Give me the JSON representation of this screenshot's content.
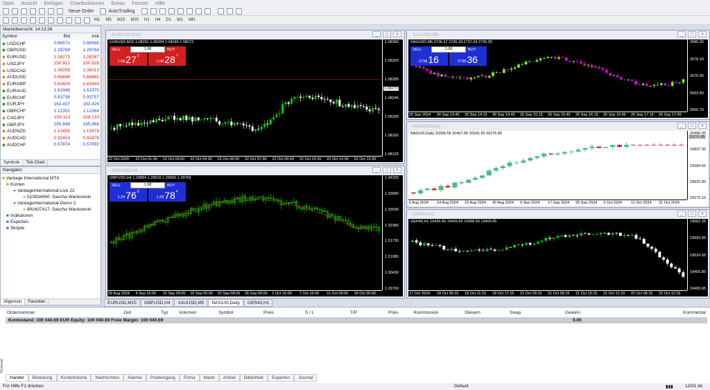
{
  "menu": [
    "Datei",
    "Ansicht",
    "Einfügen",
    "Chartfunktionen",
    "Extras",
    "Fenster",
    "Hilfe"
  ],
  "toolbar": {
    "new_order": "Neue Order",
    "autotrading": "AutoTrading",
    "timeframes": [
      "M1",
      "M5",
      "M15",
      "M30",
      "H1",
      "H4",
      "D1",
      "W1",
      "MN"
    ]
  },
  "market_watch": {
    "title": "Marktübersicht: 14:13:26",
    "col_symbol": "Symbol",
    "col_bid": "Bid",
    "col_ask": "Ask",
    "rows": [
      {
        "s": "USDCHF",
        "b": "0.86571",
        "a": "0.86586",
        "d": "up"
      },
      {
        "s": "GBPUSD",
        "b": "1.29769",
        "a": "1.29784",
        "d": "up"
      },
      {
        "s": "EURUSD",
        "b": "1.08273",
        "a": "1.08287",
        "d": "dn"
      },
      {
        "s": "USDJPY",
        "b": "150.912",
        "a": "150.928",
        "d": "dn"
      },
      {
        "s": "USDCAD",
        "b": "1.38299",
        "a": "1.38313",
        "d": "dn"
      },
      {
        "s": "AUDUSD",
        "b": "0.66848",
        "a": "0.66865",
        "d": "dn"
      },
      {
        "s": "EURGBP",
        "b": "0.83428",
        "a": "0.83443",
        "d": "dn"
      },
      {
        "s": "EURAUD",
        "b": "1.61948",
        "a": "1.61970",
        "d": "up"
      },
      {
        "s": "EURCHF",
        "b": "0.93738",
        "a": "0.93757",
        "d": "up"
      },
      {
        "s": "EURJPY",
        "b": "163.407",
        "a": "163.426",
        "d": "up"
      },
      {
        "s": "GBPCHF",
        "b": "1.12352",
        "a": "1.12364",
        "d": "up"
      },
      {
        "s": "CADJPY",
        "b": "109.113",
        "a": "109.133",
        "d": "dn"
      },
      {
        "s": "GBPJPY",
        "b": "195.848",
        "a": "195.868",
        "d": "up"
      },
      {
        "s": "AUDNZD",
        "b": "1.10455",
        "a": "1.10478",
        "d": "dn"
      },
      {
        "s": "AUDCAD",
        "b": "0.92453",
        "a": "0.92476",
        "d": "dn"
      },
      {
        "s": "AUDCHF",
        "b": "0.57874",
        "a": "0.57892",
        "d": "up"
      }
    ],
    "tabs": [
      "Symbole",
      "Tick Chart"
    ]
  },
  "navigator": {
    "title": "Navigator",
    "root": "Vantage International MT4",
    "konten": "Konten",
    "live": "VantageInternational-Live 22",
    "acct1": "510834060: Sascha Wankowski",
    "demo": "VantageInternational-Demo 2",
    "acct2": "891607417: Sascha Wankowski",
    "ind": "Indikatoren",
    "exp": "Experten",
    "scr": "Skripte",
    "tabs": [
      "Allgemein",
      "Favoriten"
    ]
  },
  "charts": [
    {
      "title": "EURUSD,M15",
      "info": "EURUSD,M15  1.08281 1.08284 1.08246 1.08273",
      "sell": "SELL",
      "buy": "BUY",
      "lot": "1.08",
      "bid_s": "1.08",
      "bid_b": "27",
      "bid_p": "3",
      "ask_s": "1.08",
      "ask_b": "28",
      "ask_p": "7",
      "yticks": [
        "1.08365",
        "1.08325",
        "1.08285",
        "1.08245",
        "1.08205",
        "1.08165",
        "1.08125"
      ],
      "price_tag": "1.08273",
      "xticks": [
        "22 Oct 2024",
        "22 Oct 01:30",
        "22 Oct 03:00",
        "22 Oct 04:30",
        "22 Oct 06:00",
        "22 Oct 07:30",
        "22 Oct 09:00",
        "22 Oct 10:30",
        "22 Oct 12:00",
        "22 Oct 13:30"
      ]
    },
    {
      "title": "XAUUSD,M5",
      "info": "XAUUSD,M5  2736.37 2736.18 2737.04 2736.39",
      "sell": "SELL",
      "buy": "BUY",
      "lot": "1.08",
      "bid_s": "2738",
      "bid_b": "16",
      "bid_p": "",
      "ask_s": "2738",
      "ask_b": "36",
      "ask_p": "",
      "yticks": [
        "2685.30",
        "2678.10",
        "2670.90",
        "2663.80",
        "2656.70"
      ],
      "xticks": [
        "26 Sep 2024",
        "26 Sep 13:45",
        "26 Sep 14:15",
        "26 Sep 14:45",
        "26 Sep 15:15",
        "26 Sep 15:45",
        "26 Sep 16:15",
        "26 Sep 16:45",
        "26 Sep 17:15",
        "26 Sep 17:45"
      ]
    },
    {
      "title": "NAS100,Daily",
      "info": "NAS100,Daily  20399.55 20407.85 20241.85 20276.85",
      "yticks": [
        "20496.05",
        "19837.00",
        "19184.56",
        "18932.90",
        "18176.10"
      ],
      "price_tag": "20276.85",
      "xticks": [
        "6 Aug 2024",
        "14 Aug 2024",
        "22 Aug 2024",
        "30 Aug 2024",
        "9 Sep 2024",
        "17 Sep 2024",
        "25 Sep 2024",
        "3 Oct 2024",
        "11 Oct 2024",
        "21 Oct 2024"
      ]
    },
    {
      "title": "GBPUSD,H4",
      "info": "GBPUSD,H4  1.29884 1.29916 1.29656 1.29769",
      "sell": "SELL",
      "buy": "BUY",
      "lot": "1.08",
      "bid_s": "1.29",
      "bid_b": "76",
      "bid_p": "9",
      "ask_s": "1.29",
      "ask_b": "78",
      "ask_p": "4",
      "yticks": [
        "1.34330",
        "1.33680",
        "1.33030",
        "1.32380",
        "1.31730",
        "1.31080",
        "1.30430",
        "1.29769"
      ],
      "xticks": [
        "29 Aug 2024",
        "4 Sep 16:00",
        "10 Sep 00:00",
        "16 Sep 00:00",
        "20 Sep 08:00",
        "26 Sep 00:00",
        "1 Oct 16:00",
        "7 Oct 16:00",
        "11 Oct 00:00",
        "18 Oct 00:00"
      ]
    },
    {
      "title": "GER40,H1",
      "info": "GER40,H1  19426.65 19426.65 19368.65 19400.65",
      "yticks": [
        "19662.25",
        "19593.49",
        "19524.55",
        "19455.80",
        "19400.65"
      ],
      "xticks": [
        "17 Oct 2024",
        "18 Oct 05:15",
        "18 Oct 11:15",
        "18 Oct 17:15",
        "21 Oct 03:15",
        "21 Oct 09:15",
        "21 Oct 15:15",
        "21 Oct 21:15",
        "22 Oct 06:15",
        "22 Oct 12:15"
      ]
    }
  ],
  "chart_tabs": [
    "EURUSD,M15",
    "GBPUSD,H4",
    "XAUUSD,M5",
    "NAS100,Daily",
    "GER40,H1"
  ],
  "terminal": {
    "cols": [
      "Ordernummer",
      "Zeit",
      "Typ",
      "Volumen",
      "Symbol",
      "Preis",
      "S / L",
      "T/P",
      "Preis",
      "Kommission",
      "Steuern",
      "Swap",
      "Gewinn",
      "Kommentar"
    ],
    "balance": "Kontostand: 100 040.69 EUR  Equity: 100 040.69  Freie Margin: 100 040.69",
    "profit": "0.00",
    "label": "Terminal",
    "tabs": [
      "Handel",
      "Belastung",
      "Kontohistorie",
      "Nachrichten",
      "Alarme",
      "Posteingang",
      "Firma",
      "Markt",
      "Artikel",
      "Bibliothek",
      "Experten",
      "Journal"
    ]
  },
  "status": {
    "help": "Für Hilfe F1 drücken",
    "profile": "Default",
    "traffic": "120/1 kb"
  },
  "colors": {
    "bull_dark": "#00c800",
    "bear_dark": "#ffffff",
    "xau_bull": "#7cfc00",
    "xau_bear": "#e000e0",
    "nas_bull": "#3cbf8f",
    "nas_bear": "#e01010",
    "accent_red": "#d21f1f",
    "accent_blue": "#1f2fd6"
  }
}
